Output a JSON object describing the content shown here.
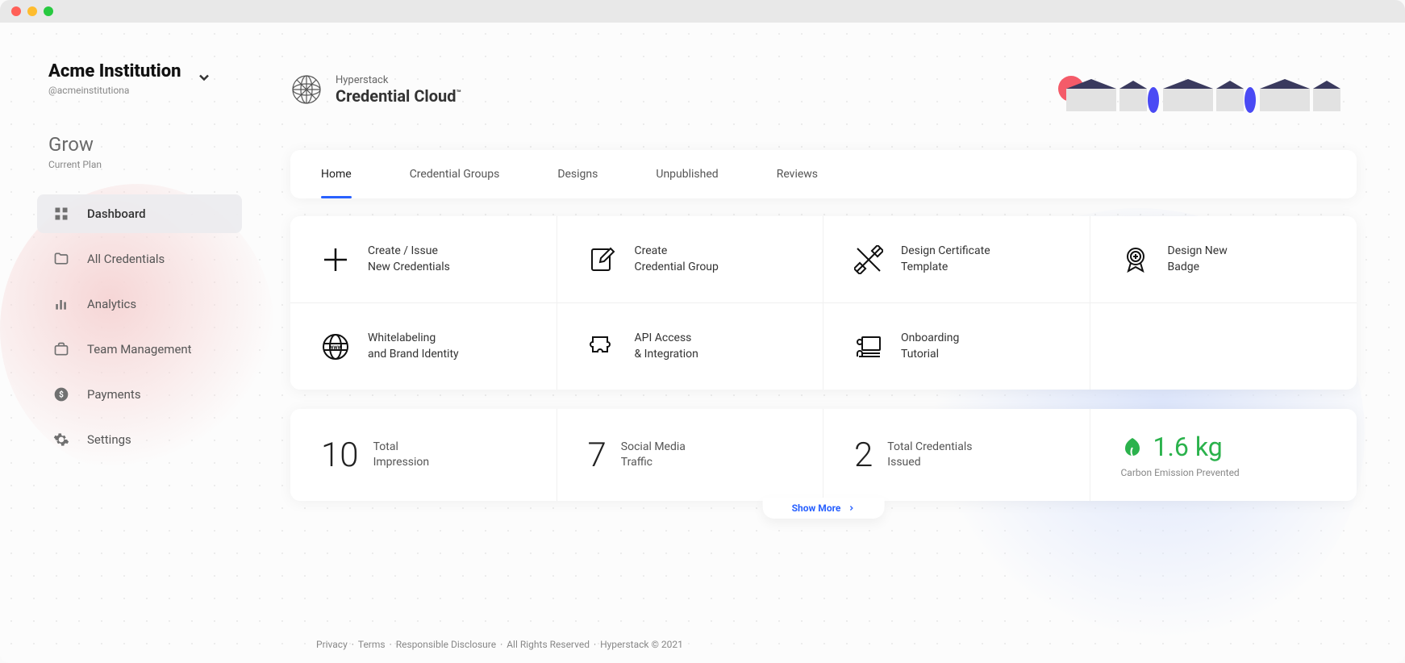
{
  "org": {
    "name": "Acme Institution",
    "handle": "@acmeinstitutiona"
  },
  "plan": {
    "name": "Grow",
    "label": "Current Plan"
  },
  "sidebar": {
    "items": [
      {
        "label": "Dashboard"
      },
      {
        "label": "All Credentials"
      },
      {
        "label": "Analytics"
      },
      {
        "label": "Team Management"
      },
      {
        "label": "Payments"
      },
      {
        "label": "Settings"
      }
    ]
  },
  "brand": {
    "sup": "Hyperstack",
    "main": "Credential Cloud"
  },
  "tabs": [
    {
      "label": "Home"
    },
    {
      "label": "Credential Groups"
    },
    {
      "label": "Designs"
    },
    {
      "label": "Unpublished"
    },
    {
      "label": "Reviews"
    }
  ],
  "actions": [
    {
      "line1": "Create / Issue",
      "line2": "New Credentials"
    },
    {
      "line1": "Create",
      "line2": "Credential Group"
    },
    {
      "line1": "Design Certificate",
      "line2": "Template"
    },
    {
      "line1": "Design New",
      "line2": "Badge"
    },
    {
      "line1": "Whitelabeling",
      "line2": "and Brand Identity"
    },
    {
      "line1": "API Access",
      "line2": "& Integration"
    },
    {
      "line1": "Onboarding",
      "line2": "Tutorial"
    }
  ],
  "stats": {
    "impression": {
      "value": "10",
      "label1": "Total",
      "label2": "Impression"
    },
    "social": {
      "value": "7",
      "label1": "Social Media",
      "label2": "Traffic"
    },
    "issued": {
      "value": "2",
      "label1": "Total Credentials",
      "label2": "Issued"
    },
    "carbon": {
      "value": "1.6 kg",
      "label": "Carbon Emission Prevented"
    }
  },
  "show_more": "Show More",
  "footer": {
    "privacy": "Privacy",
    "terms": "Terms",
    "disclosure": "Responsible Disclosure",
    "rights": "All Rights Reserved",
    "copy": "Hyperstack © 2021"
  }
}
